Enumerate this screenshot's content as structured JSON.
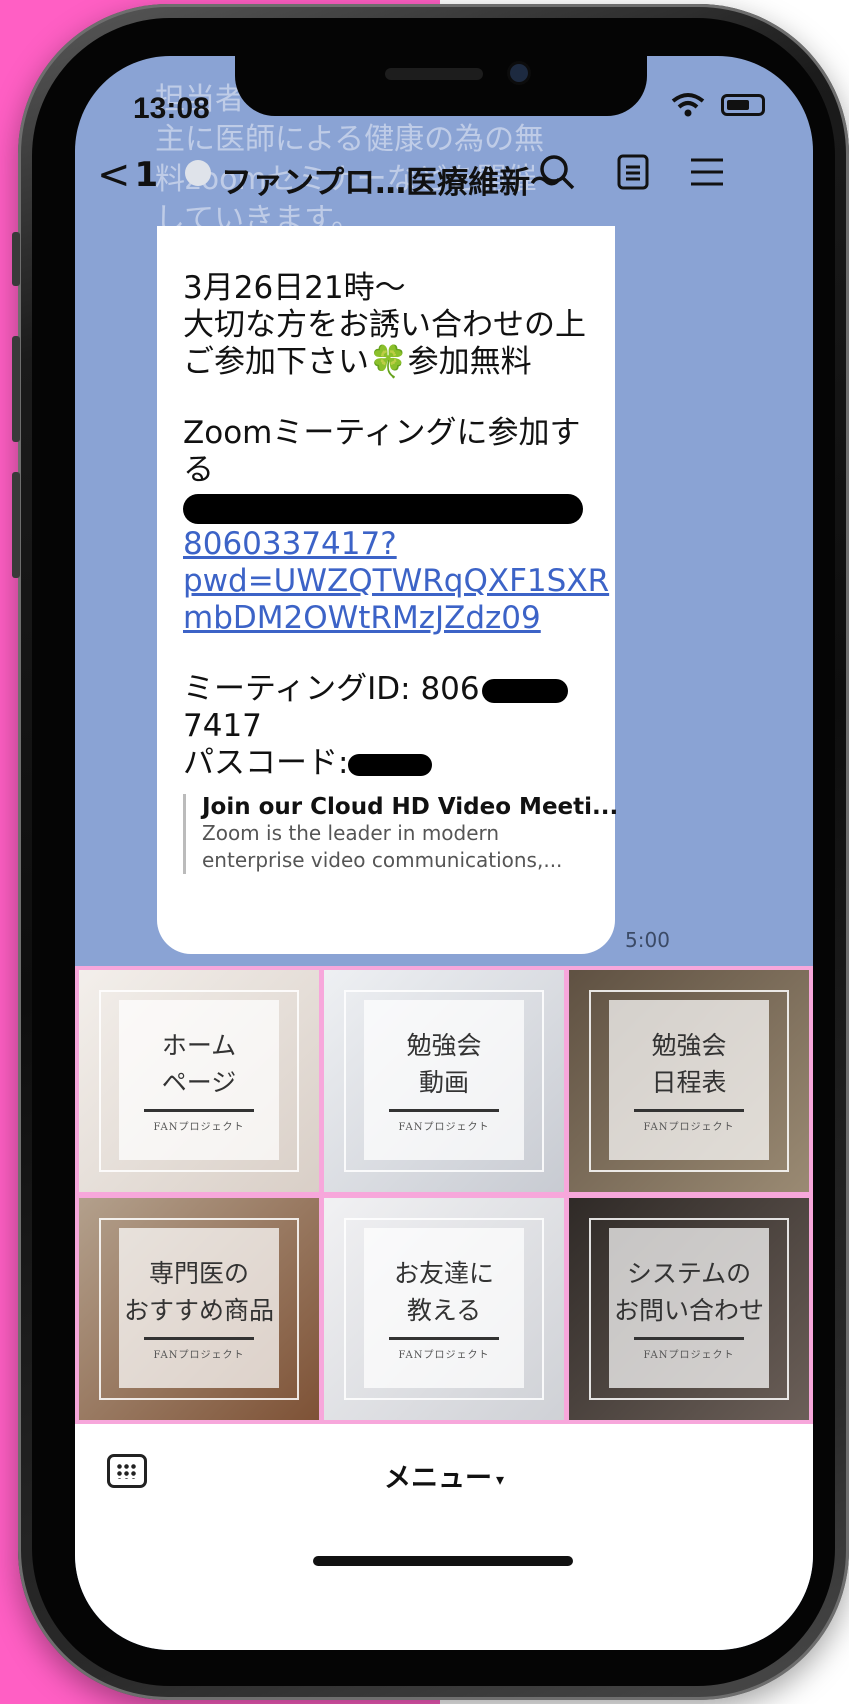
{
  "status_bar": {
    "time": "13:08"
  },
  "background_text": [
    "担当者",
    "主に医師による健康の為の無",
    "料zoomセミナーなどを開催",
    "していきます。"
  ],
  "header": {
    "back_label": "1",
    "title": "ファンプロ…医療維新〜"
  },
  "message": {
    "lines_1": [
      "3月26日21時〜",
      "大切な方をお誘い合わせの上",
      "ご参加下さい🍀参加無料"
    ],
    "lines_2": [
      "Zoomミーティングに参加す",
      "る"
    ],
    "link_lines": [
      "8060337417?",
      "pwd=UWZQTWRqQXF1SXR",
      "mbDM2OWtRMzJZdz09"
    ],
    "meeting_id_label": "ミーティングID: 806",
    "meeting_id_tail": "7417",
    "passcode_label": "パスコード:",
    "preview_title": "Join our Cloud HD Video Meeti...",
    "preview_desc_1": "Zoom is the leader in modern",
    "preview_desc_2": "enterprise video communications,...",
    "time": "5:00"
  },
  "rich_menu": {
    "subtitle": "FANプロジェクト",
    "tiles": [
      {
        "label": "ホーム\nページ",
        "color": "#e9e2dc"
      },
      {
        "label": "勉強会\n動画",
        "color": "#d7d9de"
      },
      {
        "label": "勉強会\n日程表",
        "color": "#7a6b58"
      },
      {
        "label": "専門医の\nおすすめ商品",
        "color": "#9a7a5c"
      },
      {
        "label": "お友達に\n教える",
        "color": "#e6e7ea"
      },
      {
        "label": "システムの\nお問い合わせ",
        "color": "#3e3835"
      }
    ]
  },
  "bottom_bar": {
    "menu_label": "メニュー",
    "caret": "▾"
  }
}
